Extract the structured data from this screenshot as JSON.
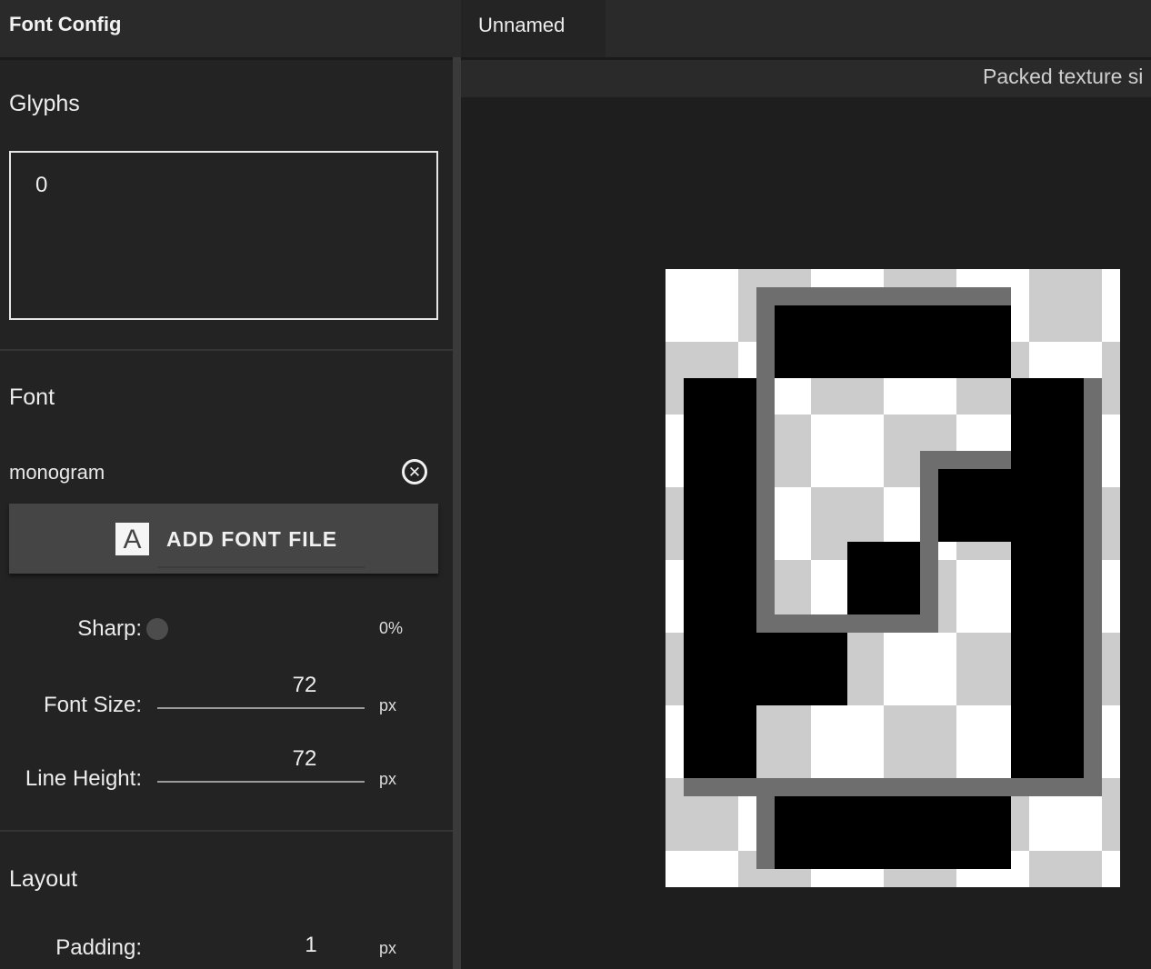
{
  "app": {
    "title": "Font Config"
  },
  "tabs": [
    {
      "label": "Unnamed"
    }
  ],
  "glyphs": {
    "heading": "Glyphs",
    "text": "0"
  },
  "font": {
    "heading": "Font",
    "name": "monogram",
    "remove_icon": "close-circle-icon",
    "add_label": "ADD FONT FILE",
    "add_icon": "font-file-icon"
  },
  "sharp": {
    "label": "Sharp:",
    "value": "0%",
    "level": 0
  },
  "font_size": {
    "label": "Font Size:",
    "value": "72",
    "unit": "px"
  },
  "line_height": {
    "label": "Line Height:",
    "value": "72",
    "unit": "px"
  },
  "layout": {
    "heading": "Layout"
  },
  "padding": {
    "label": "Padding:",
    "value": "1",
    "unit": "px"
  },
  "preview": {
    "info": "Packed texture si"
  },
  "colors": {
    "background": "#222222",
    "panel": "#232323",
    "button": "#454545"
  }
}
